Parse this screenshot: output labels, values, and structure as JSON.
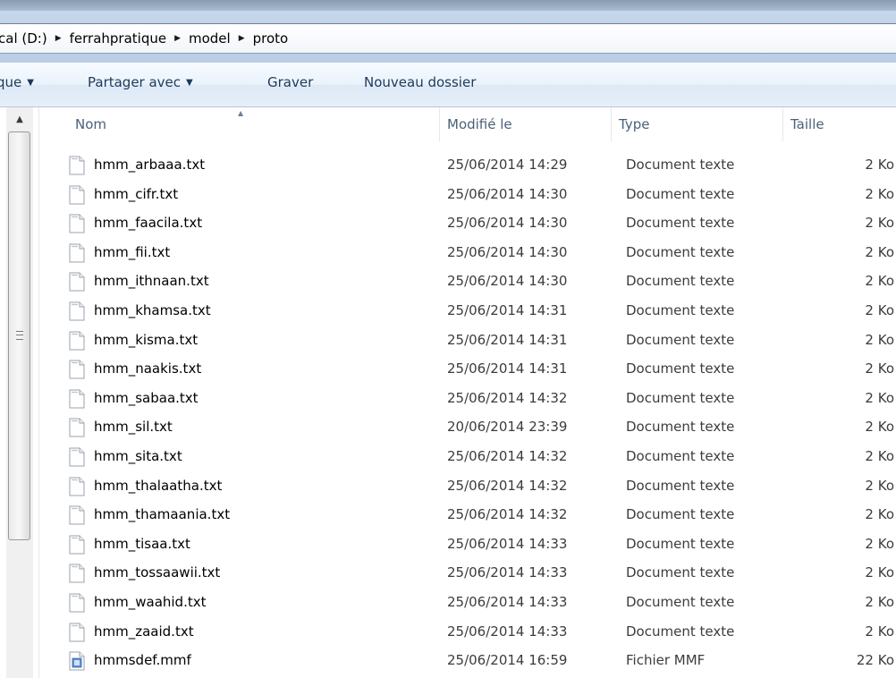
{
  "address_bar": {
    "crumbs": [
      "cal (D:)",
      "ferrahpratique",
      "model",
      "proto"
    ]
  },
  "command_bar": {
    "organize_label": "que",
    "share_label": "Partager avec",
    "burn_label": "Graver",
    "new_folder_label": "Nouveau dossier"
  },
  "columns": {
    "name": "Nom",
    "date": "Modifié le",
    "type": "Type",
    "size": "Taille"
  },
  "files": [
    {
      "name": "hmm_arbaaa.txt",
      "date": "25/06/2014 14:29",
      "type": "Document texte",
      "size": "2 Ko",
      "icon": "text-file-icon"
    },
    {
      "name": "hmm_cifr.txt",
      "date": "25/06/2014 14:30",
      "type": "Document texte",
      "size": "2 Ko",
      "icon": "text-file-icon"
    },
    {
      "name": "hmm_faacila.txt",
      "date": "25/06/2014 14:30",
      "type": "Document texte",
      "size": "2 Ko",
      "icon": "text-file-icon"
    },
    {
      "name": "hmm_fii.txt",
      "date": "25/06/2014 14:30",
      "type": "Document texte",
      "size": "2 Ko",
      "icon": "text-file-icon"
    },
    {
      "name": "hmm_ithnaan.txt",
      "date": "25/06/2014 14:30",
      "type": "Document texte",
      "size": "2 Ko",
      "icon": "text-file-icon"
    },
    {
      "name": "hmm_khamsa.txt",
      "date": "25/06/2014 14:31",
      "type": "Document texte",
      "size": "2 Ko",
      "icon": "text-file-icon"
    },
    {
      "name": "hmm_kisma.txt",
      "date": "25/06/2014 14:31",
      "type": "Document texte",
      "size": "2 Ko",
      "icon": "text-file-icon"
    },
    {
      "name": "hmm_naakis.txt",
      "date": "25/06/2014 14:31",
      "type": "Document texte",
      "size": "2 Ko",
      "icon": "text-file-icon"
    },
    {
      "name": "hmm_sabaa.txt",
      "date": "25/06/2014 14:32",
      "type": "Document texte",
      "size": "2 Ko",
      "icon": "text-file-icon"
    },
    {
      "name": "hmm_sil.txt",
      "date": "20/06/2014 23:39",
      "type": "Document texte",
      "size": "2 Ko",
      "icon": "text-file-icon"
    },
    {
      "name": "hmm_sita.txt",
      "date": "25/06/2014 14:32",
      "type": "Document texte",
      "size": "2 Ko",
      "icon": "text-file-icon"
    },
    {
      "name": "hmm_thalaatha.txt",
      "date": "25/06/2014 14:32",
      "type": "Document texte",
      "size": "2 Ko",
      "icon": "text-file-icon"
    },
    {
      "name": "hmm_thamaania.txt",
      "date": "25/06/2014 14:32",
      "type": "Document texte",
      "size": "2 Ko",
      "icon": "text-file-icon"
    },
    {
      "name": "hmm_tisaa.txt",
      "date": "25/06/2014 14:33",
      "type": "Document texte",
      "size": "2 Ko",
      "icon": "text-file-icon"
    },
    {
      "name": "hmm_tossaawii.txt",
      "date": "25/06/2014 14:33",
      "type": "Document texte",
      "size": "2 Ko",
      "icon": "text-file-icon"
    },
    {
      "name": "hmm_waahid.txt",
      "date": "25/06/2014 14:33",
      "type": "Document texte",
      "size": "2 Ko",
      "icon": "text-file-icon"
    },
    {
      "name": "hmm_zaaid.txt",
      "date": "25/06/2014 14:33",
      "type": "Document texte",
      "size": "2 Ko",
      "icon": "text-file-icon"
    },
    {
      "name": "hmmsdef.mmf",
      "date": "25/06/2014 16:59",
      "type": "Fichier MMF",
      "size": "22 Ko",
      "icon": "mmf-file-icon"
    }
  ],
  "colors": {
    "command_text": "#1e395b",
    "header_text": "#4c607a",
    "command_bar_bg": "#e6eff9"
  }
}
